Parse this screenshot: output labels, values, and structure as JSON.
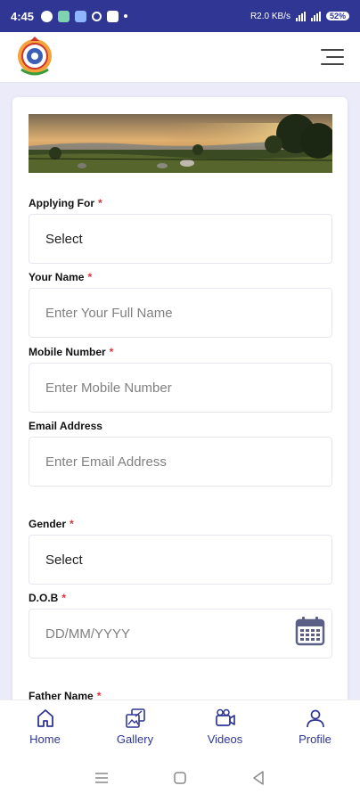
{
  "status_bar": {
    "time": "4:45",
    "network_text": "R2.0 KB/s",
    "battery": "52%"
  },
  "header": {
    "logo_icon": "emblem-logo-icon",
    "menu_icon": "hamburger-menu-icon"
  },
  "form": {
    "applying_for": {
      "label": "Applying For",
      "required": "*",
      "value": "Select"
    },
    "your_name": {
      "label": "Your Name",
      "required": "*",
      "placeholder": "Enter Your Full Name"
    },
    "mobile_number": {
      "label": "Mobile Number",
      "required": "*",
      "placeholder": "Enter Mobile Number"
    },
    "email_address": {
      "label": "Email Address",
      "placeholder": "Enter Email Address"
    },
    "gender": {
      "label": "Gender",
      "required": "*",
      "value": "Select"
    },
    "dob": {
      "label": "D.O.B",
      "required": "*",
      "placeholder": "DD/MM/YYYY"
    },
    "father_name": {
      "label": "Father Name",
      "required": "*"
    }
  },
  "bottom_nav": {
    "items": [
      {
        "label": "Home",
        "icon": "home-icon"
      },
      {
        "label": "Gallery",
        "icon": "gallery-icon"
      },
      {
        "label": "Videos",
        "icon": "videos-icon"
      },
      {
        "label": "Profile",
        "icon": "profile-icon"
      }
    ]
  },
  "colors": {
    "primary": "#2f3694",
    "background": "#ecebfa",
    "required": "#e0303a"
  }
}
